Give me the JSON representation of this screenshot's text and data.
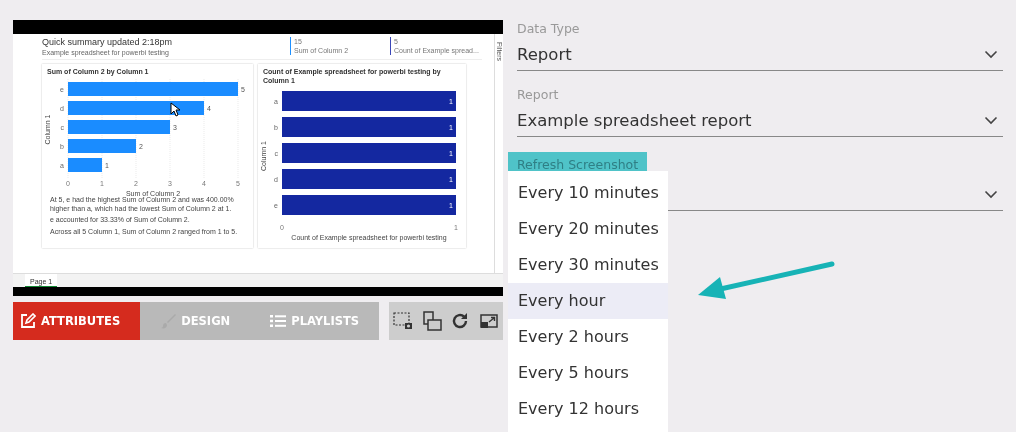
{
  "preview": {
    "title": "Quick summary updated 2:18pm",
    "subtitle": "Example spreadsheet for powerbi testing",
    "kpis": [
      {
        "value": "15",
        "label": "Sum of Column 2",
        "color": "#1e90ff"
      },
      {
        "value": "5",
        "label": "Count of Example spread...",
        "color": "#3b47b8"
      }
    ],
    "filters_label": "Filters",
    "visuals": [
      {
        "title": "Sum of Column 2 by Column 1",
        "chart_data": {
          "type": "bar",
          "orientation": "horizontal",
          "categories": [
            "e",
            "d",
            "c",
            "b",
            "a"
          ],
          "values": [
            5,
            4,
            3,
            2,
            1
          ],
          "xlabel": "Sum of Column 2",
          "ylabel": "Column 1",
          "xticks": [
            0,
            1,
            2,
            3,
            4,
            5
          ],
          "xlim": [
            0,
            5
          ],
          "grid": true,
          "data_labels": true
        },
        "narrative": [
          "At 5, e had the highest Sum of Column 2 and was 400.00% higher than a, which had the lowest Sum of Column 2 at 1.",
          "e accounted for 33.33% of Sum of Column 2.",
          "Across all 5 Column 1, Sum of Column 2 ranged from 1 to 5."
        ]
      },
      {
        "title": "Count of Example spreadsheet for powerbi testing by Column 1",
        "chart_data": {
          "type": "bar",
          "orientation": "horizontal",
          "categories": [
            "a",
            "b",
            "c",
            "d",
            "e"
          ],
          "values": [
            1,
            1,
            1,
            1,
            1
          ],
          "xlabel": "Count of Example spreadsheet for powerbi testing",
          "ylabel": "Column 1",
          "xticks": [
            0,
            1
          ],
          "xlim": [
            0,
            1
          ],
          "grid": false,
          "data_labels": true
        }
      }
    ],
    "page_tabs": [
      {
        "label": "Page 1",
        "selected": true
      }
    ]
  },
  "toolbar": {
    "tabs": [
      {
        "label": "ATTRIBUTES",
        "kind": "edit",
        "selected": true
      },
      {
        "label": "DESIGN",
        "kind": "brush",
        "selected": false
      },
      {
        "label": "PLAYLISTS",
        "kind": "list",
        "selected": false
      }
    ],
    "tools": [
      {
        "kind": "capture"
      },
      {
        "kind": "layers"
      },
      {
        "kind": "refresh"
      },
      {
        "kind": "popout"
      }
    ]
  },
  "form": {
    "fields": [
      {
        "label": "Data Type",
        "value": "Report",
        "focused": false
      },
      {
        "label": "Report",
        "value": "Example spreadsheet report",
        "focused": false
      },
      {
        "label": "Refresh Screenshot",
        "focused": true,
        "options": [
          {
            "label": "Every 10 minutes",
            "selected": false
          },
          {
            "label": "Every 20 minutes",
            "selected": false
          },
          {
            "label": "Every 30 minutes",
            "selected": false
          },
          {
            "label": "Every hour",
            "selected": true
          },
          {
            "label": "Every 2 hours",
            "selected": false
          },
          {
            "label": "Every 5 hours",
            "selected": false
          },
          {
            "label": "Every 12 hours",
            "selected": false
          }
        ]
      }
    ]
  }
}
